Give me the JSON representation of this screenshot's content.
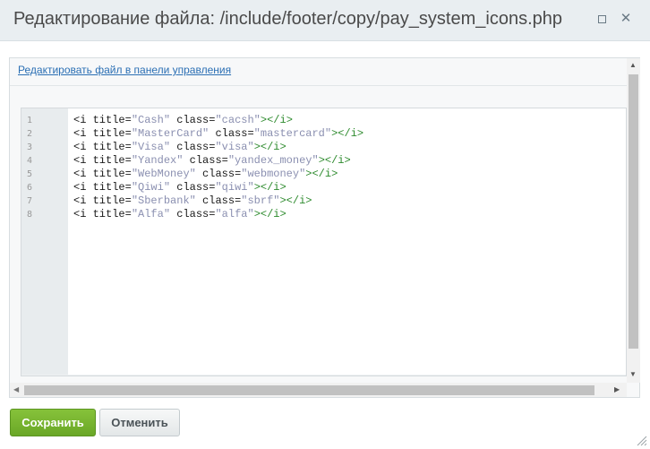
{
  "dialog": {
    "title": "Редактирование файла: /include/footer/copy/pay_system_icons.php"
  },
  "toolbar": {
    "edit_link": "Редактировать файл в панели управления"
  },
  "editor": {
    "lines": [
      {
        "num": "1",
        "title": "Cash",
        "class": "cacsh"
      },
      {
        "num": "2",
        "title": "MasterCard",
        "class": "mastercard"
      },
      {
        "num": "3",
        "title": "Visa",
        "class": "visa"
      },
      {
        "num": "4",
        "title": "Yandex",
        "class": "yandex_money"
      },
      {
        "num": "5",
        "title": "WebMoney",
        "class": "webmoney"
      },
      {
        "num": "6",
        "title": "Qiwi",
        "class": "qiwi"
      },
      {
        "num": "7",
        "title": "Sberbank",
        "class": "sbrf"
      },
      {
        "num": "8",
        "title": "Alfa",
        "class": "alfa"
      }
    ],
    "tokens": {
      "open": "<i ",
      "title_attr": "title=",
      "class_attr": " class=",
      "close": "></i>"
    }
  },
  "buttons": {
    "save": "Сохранить",
    "cancel": "Отменить"
  },
  "colors": {
    "accent": "#6aa727",
    "link": "#2b6fb4",
    "value": "#8a8fb0",
    "close_tag": "#2e8b2e"
  }
}
